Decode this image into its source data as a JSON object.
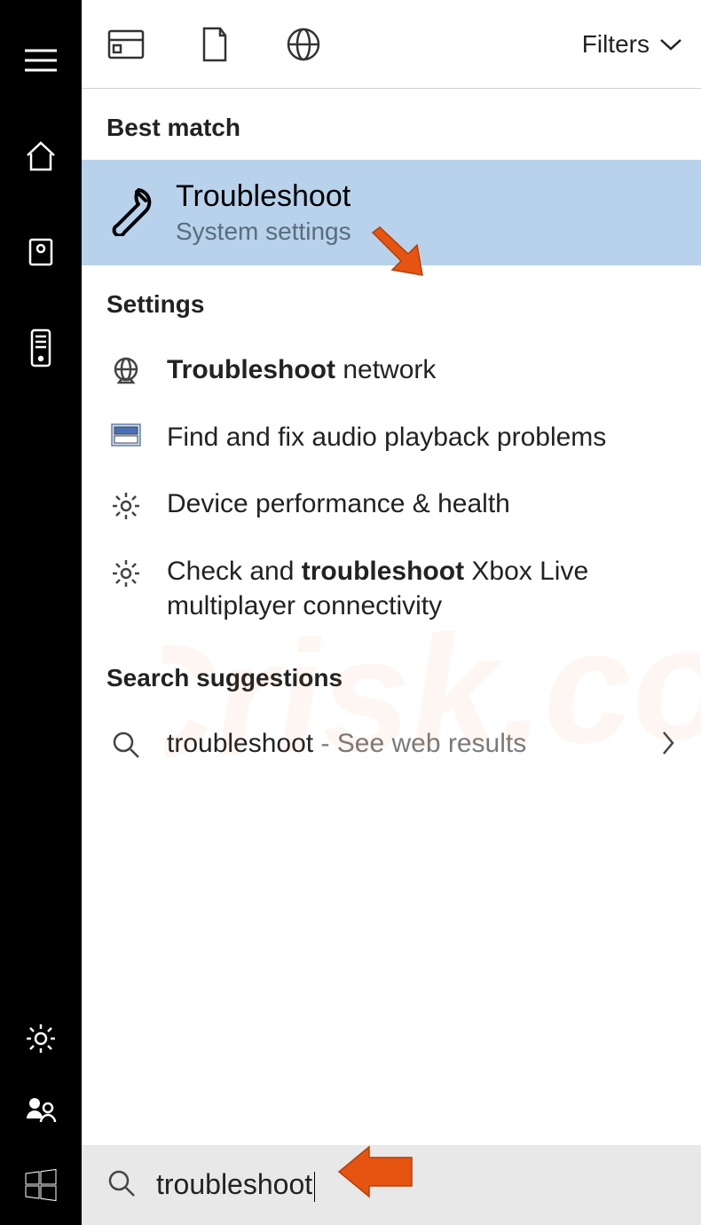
{
  "sidebar": {
    "icons": [
      "menu",
      "home",
      "reading-list",
      "remote",
      "settings",
      "people",
      "start"
    ]
  },
  "top_tabs": {
    "icons": [
      "apps",
      "documents",
      "web"
    ],
    "filters_label": "Filters"
  },
  "sections": {
    "best_match_header": "Best match",
    "settings_header": "Settings",
    "suggestions_header": "Search suggestions"
  },
  "best_match": {
    "title": "Troubleshoot",
    "subtitle": "System settings"
  },
  "settings_items": [
    {
      "icon": "globe",
      "bolded": "Troubleshoot",
      "rest": " network"
    },
    {
      "icon": "monitor",
      "bolded": "",
      "rest": "Find and fix audio playback problems"
    },
    {
      "icon": "gear",
      "bolded": "",
      "rest": "Device performance & health"
    },
    {
      "icon": "gear",
      "bolded": "troubleshoot",
      "pre": "Check and ",
      "rest": " Xbox Live multiplayer connectivity"
    }
  ],
  "suggestion": {
    "query": "troubleshoot",
    "tail": " - See web results"
  },
  "search": {
    "text": "troubleshoot"
  },
  "watermark": "PCrisk.com",
  "colors": {
    "highlight": "#b8d2ec",
    "sidebar": "#000000",
    "searchbar": "#e8e8e8",
    "arrow": "#e65411"
  }
}
